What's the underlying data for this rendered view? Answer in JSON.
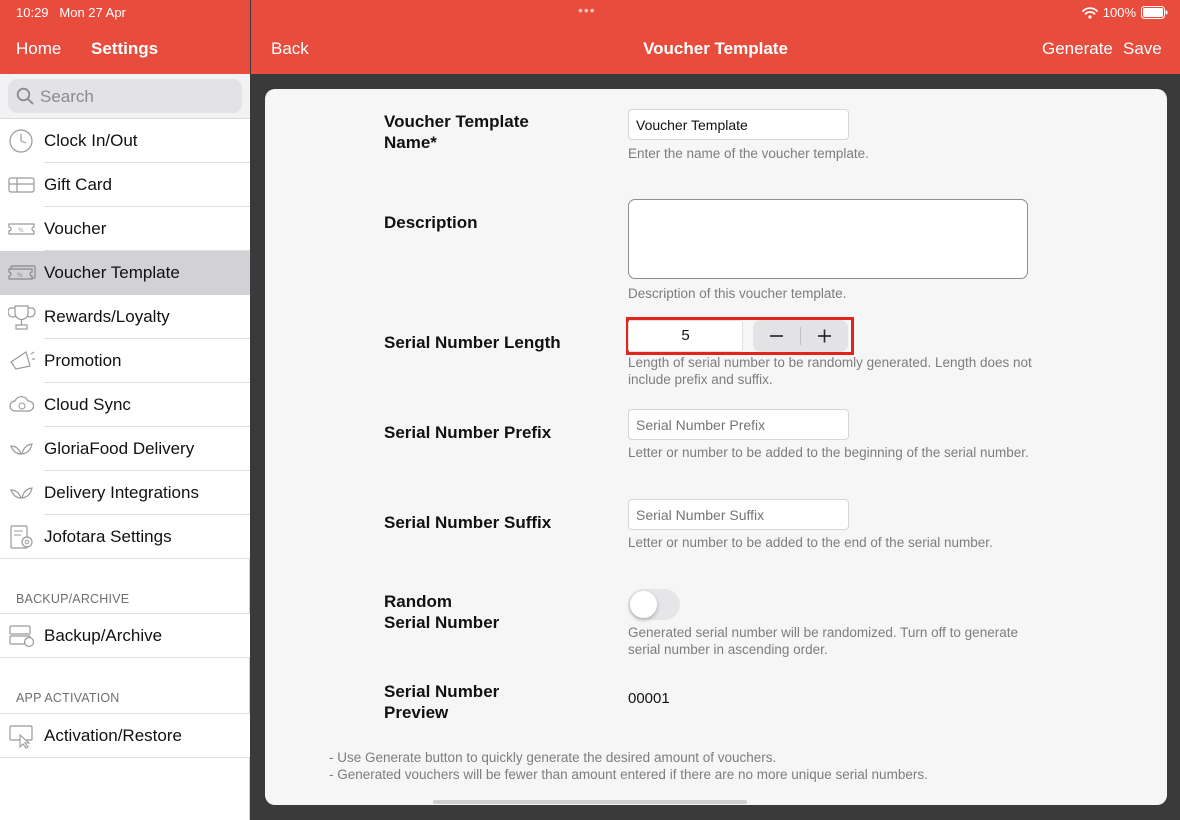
{
  "status": {
    "time": "10:29",
    "date": "Mon 27 Apr",
    "battery": "100%"
  },
  "sidebar": {
    "home_label": "Home",
    "title": "Settings",
    "search_placeholder": "Search",
    "items": [
      {
        "label": "Clock In/Out",
        "icon": "clock-icon"
      },
      {
        "label": "Gift Card",
        "icon": "gift-card-icon"
      },
      {
        "label": "Voucher",
        "icon": "voucher-icon"
      },
      {
        "label": "Voucher Template",
        "icon": "voucher-template-icon",
        "selected": true
      },
      {
        "label": "Rewards/Loyalty",
        "icon": "trophy-icon"
      },
      {
        "label": "Promotion",
        "icon": "megaphone-icon"
      },
      {
        "label": "Cloud Sync",
        "icon": "cloud-sync-icon"
      },
      {
        "label": "GloriaFood Delivery",
        "icon": "leaf-icon"
      },
      {
        "label": "Delivery Integrations",
        "icon": "leaf-icon"
      },
      {
        "label": "Jofotara Settings",
        "icon": "document-settings-icon"
      }
    ],
    "section_backup": "BACKUP/ARCHIVE",
    "backup_item": {
      "label": "Backup/Archive",
      "icon": "backup-icon"
    },
    "section_activation": "APP ACTIVATION",
    "activation_item": {
      "label": "Activation/Restore",
      "icon": "activation-icon"
    }
  },
  "header": {
    "back_label": "Back",
    "title": "Voucher Template",
    "generate_label": "Generate",
    "save_label": "Save"
  },
  "form": {
    "name": {
      "label_line1": "Voucher Template",
      "label_line2": "Name*",
      "value": "Voucher Template",
      "help": "Enter the name of the voucher template."
    },
    "description": {
      "label": "Description",
      "value": "",
      "help": "Description of this voucher template."
    },
    "serial_length": {
      "label": "Serial Number Length",
      "value": "5",
      "help_line1": "Length of serial number to be randomly generated. Length does not",
      "help_line2": "include prefix and suffix."
    },
    "prefix": {
      "label": "Serial Number Prefix",
      "placeholder": "Serial Number Prefix",
      "help": "Letter or number to be added to the beginning of the serial number."
    },
    "suffix": {
      "label": "Serial Number Suffix",
      "placeholder": "Serial Number Suffix",
      "help": "Letter or number to be added to the end of the serial number."
    },
    "random": {
      "label_line1": "Random",
      "label_line2": "Serial Number",
      "enabled": false,
      "help_line1": "Generated serial number will be randomized. Turn off to generate",
      "help_line2": "serial number in ascending order."
    },
    "preview": {
      "label_line1": "Serial Number",
      "label_line2": "Preview",
      "value": "00001"
    }
  },
  "notes": [
    "- Use Generate button to quickly generate the desired amount of vouchers.",
    "- Generated vouchers will be fewer than amount entered if there are no more unique serial numbers."
  ],
  "colors": {
    "accent": "#e84c3d",
    "highlight_border": "#e3241c",
    "selected_row": "#d1d1d6"
  }
}
